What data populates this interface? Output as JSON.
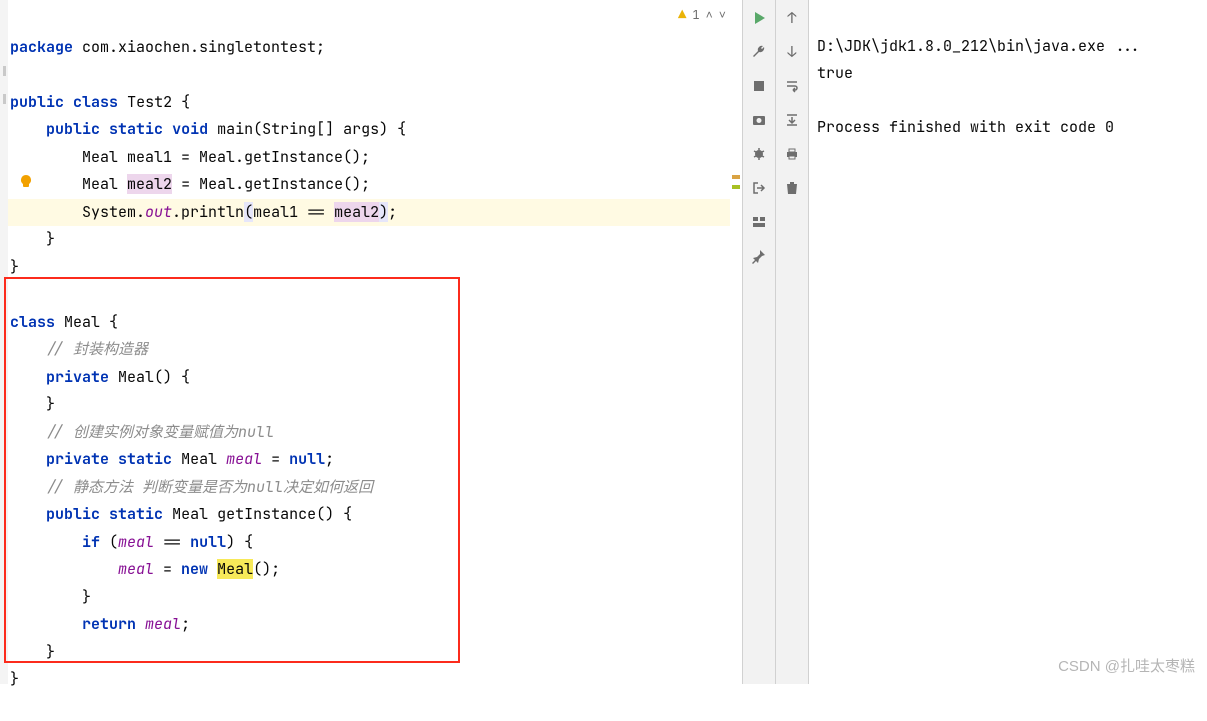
{
  "editor": {
    "package_kw": "package",
    "package_name": "com.xiaochen.singletontest;",
    "public": "public",
    "class": "class",
    "test2": "Test2",
    "static": "static",
    "void": "void",
    "main": "main",
    "main_args": "(String[] args)",
    "meal_type": "Meal",
    "meal1_decl": "meal1 = Meal.getInstance();",
    "meal2_var": "meal2",
    "meal2_rest": " = Meal.getInstance();",
    "sys": "System.",
    "out": "out",
    "println": ".println",
    "print_open": "(",
    "print_arg1": "meal1 == ",
    "print_arg2": "meal2",
    "print_close": ")",
    "semicolon": ";",
    "meal_class": "Meal",
    "cmt1": "// 封装构造器",
    "private": "private",
    "ctor": "Meal() {",
    "cmt2": "// 创建实例对象变量赋值为null",
    "meal_field": "meal",
    "assign_null": " = ",
    "null_kw": "null",
    "cmt3": "// 静态方法 判断变量是否为null决定如何返回",
    "getinst": "getInstance",
    "if_kw": "if",
    "if_cond_open": " (",
    "if_cond_close": ") {",
    "eqeq": " == ",
    "assign_new": " = ",
    "new_kw": "new",
    "meal_ctor_call": "Meal",
    "ctor_parens": "();",
    "return_kw": "return",
    "warning_count": "1"
  },
  "console": {
    "path": "D:\\JDK\\jdk1.8.0_212\\bin\\java.exe ...",
    "out1": "true",
    "exit": "Process finished with exit code 0"
  },
  "watermark": "CSDN @扎哇太枣糕"
}
